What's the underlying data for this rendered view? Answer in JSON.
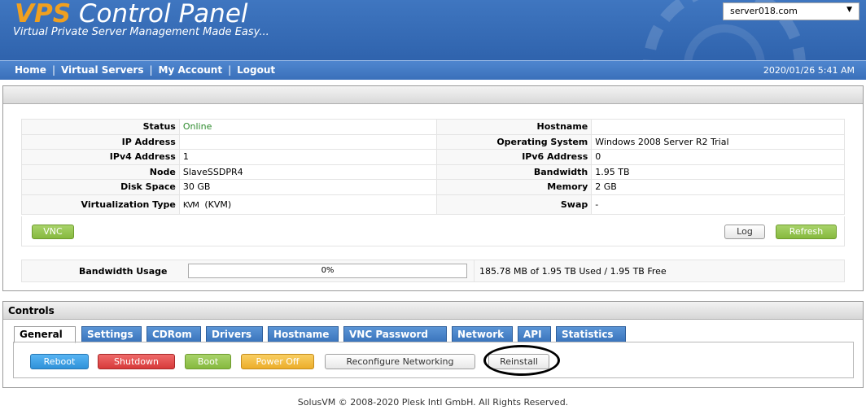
{
  "header": {
    "brand_accent": "VPS",
    "brand_rest": " Control Panel",
    "tagline": "Virtual Private Server Management Made Easy...",
    "server_select": "server018.com"
  },
  "nav": {
    "links": [
      "Home",
      "Virtual Servers",
      "My Account",
      "Logout"
    ],
    "separator": "|",
    "datetime": "2020/01/26 5:41 AM"
  },
  "info": {
    "left": [
      {
        "label": "Status",
        "value": "Online"
      },
      {
        "label": "IP Address",
        "value": ""
      },
      {
        "label": "IPv4 Address",
        "value": "1"
      },
      {
        "label": "Node",
        "value": "SlaveSSDPR4"
      },
      {
        "label": "Disk Space",
        "value": "30 GB"
      },
      {
        "label": "Virtualization Type",
        "value_icon": "KVM",
        "value": "(KVM)"
      }
    ],
    "right": [
      {
        "label": "Hostname",
        "value": ""
      },
      {
        "label": "Operating System",
        "value": "Windows 2008 Server R2 Trial"
      },
      {
        "label": "IPv6 Address",
        "value": "0"
      },
      {
        "label": "Bandwidth",
        "value": "1.95 TB"
      },
      {
        "label": "Memory",
        "value": "2 GB"
      },
      {
        "label": "Swap",
        "value": "-"
      }
    ],
    "vnc_button": "VNC",
    "log_button": "Log",
    "refresh_button": "Refresh",
    "bandwidth_label": "Bandwidth Usage",
    "bandwidth_percent": "0%",
    "bandwidth_used_text": "185.78 MB of 1.95 TB Used / 1.95 TB Free"
  },
  "controls": {
    "title": "Controls",
    "tabs": [
      "General",
      "Settings",
      "CDRom",
      "Drivers",
      "Hostname",
      "VNC Password",
      "Network",
      "API",
      "Statistics"
    ],
    "active_tab": "General",
    "buttons": {
      "reboot": "Reboot",
      "shutdown": "Shutdown",
      "boot": "Boot",
      "power_off": "Power Off",
      "reconfigure": "Reconfigure Networking",
      "reinstall": "Reinstall"
    }
  },
  "footer": "SolusVM © 2008-2020 Plesk Intl GmbH. All Rights Reserved.",
  "colors": {
    "header_blue": "#3f76c0",
    "brand_accent": "#f0a020",
    "online_green": "#2e8b2e",
    "button_green": "#86b93e",
    "button_blue": "#2f92d9",
    "button_red": "#d73a3a",
    "button_yellow": "#ecae2a"
  }
}
